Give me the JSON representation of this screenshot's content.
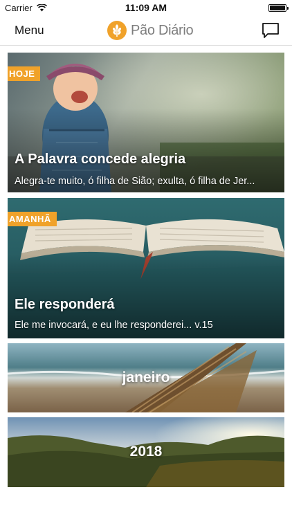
{
  "status_bar": {
    "carrier": "Carrier",
    "time": "11:09 AM",
    "battery_level": 1.0
  },
  "nav": {
    "menu_label": "Menu",
    "brand_name": "Pão Diário",
    "brand_color": "#f0a22a",
    "chat_icon": "chat-bubble-icon"
  },
  "cards": [
    {
      "badge": "HOJE",
      "title": "A Palavra concede alegria",
      "excerpt": "Alegra-te muito, ó filha de Sião; exulta, ó filha de Jer..."
    },
    {
      "badge": "AMANHÃ",
      "title": "Ele responderá",
      "excerpt": "Ele me invocará, e eu lhe responderei... v.15"
    },
    {
      "label": "janeiro"
    },
    {
      "label": "2018"
    }
  ]
}
